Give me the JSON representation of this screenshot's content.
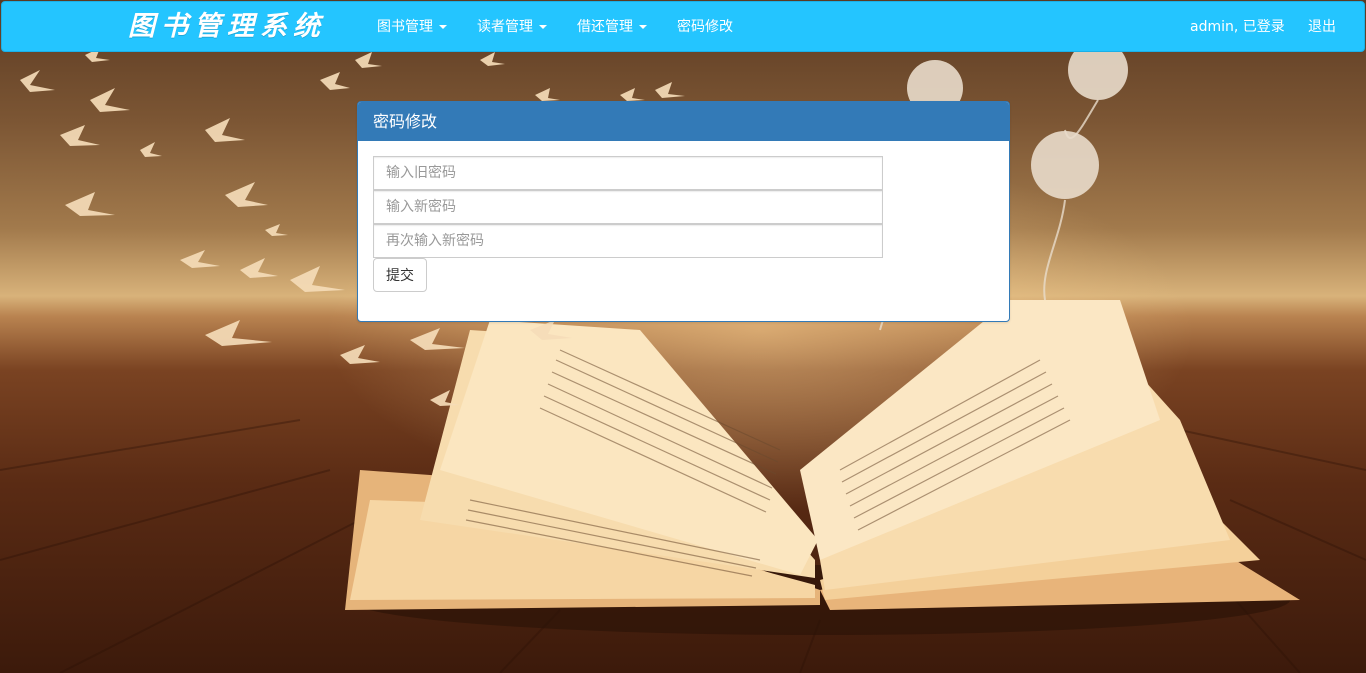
{
  "navbar": {
    "brand": "图书管理系统",
    "menu": [
      {
        "label": "图书管理",
        "dropdown": true
      },
      {
        "label": "读者管理",
        "dropdown": true
      },
      {
        "label": "借还管理",
        "dropdown": true
      },
      {
        "label": "密码修改",
        "dropdown": false
      }
    ],
    "user_status": "admin, 已登录",
    "logout_label": "退出",
    "color": "#24c5ff"
  },
  "panel": {
    "title": "密码修改",
    "old_password_placeholder": "输入旧密码",
    "new_password_placeholder": "输入新密码",
    "confirm_password_placeholder": "再次输入新密码",
    "submit_label": "提交",
    "heading_color": "#337ab7"
  }
}
